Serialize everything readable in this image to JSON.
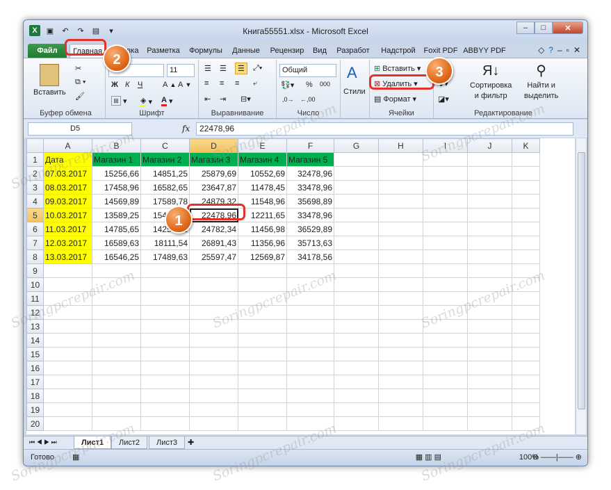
{
  "window": {
    "title": "Книга55551.xlsx - Microsoft Excel",
    "file_tab": "Файл",
    "tabs": [
      "Главная",
      "Вставка",
      "Разметка",
      "Формулы",
      "Данные",
      "Рецензир",
      "Вид",
      "Разработ",
      "Надстрой",
      "Foxit PDF",
      "ABBYY PDF"
    ]
  },
  "ribbon": {
    "clipboard": {
      "paste": "Вставить",
      "label": "Буфер обмена"
    },
    "font": {
      "name": "",
      "size": "11",
      "bold": "Ж",
      "italic": "К",
      "underline": "Ч",
      "label": "Шрифт"
    },
    "alignment": {
      "label": "Выравнивание"
    },
    "number": {
      "format": "Общий",
      "percent": "%",
      "thousands": "000",
      "label": "Число"
    },
    "styles": {
      "label": "Стили"
    },
    "cells": {
      "insert": "Вставить",
      "delete": "Удалить",
      "format": "Формат",
      "label": "Ячейки"
    },
    "editing": {
      "sort": "Сортировка",
      "sort2": "и фильтр",
      "find": "Найти и",
      "find2": "выделить",
      "label": "Редактирование"
    }
  },
  "formula": {
    "name_box": "D5",
    "fx": "fx",
    "value": "22478,96"
  },
  "grid": {
    "columns": [
      "A",
      "B",
      "C",
      "D",
      "E",
      "F",
      "G",
      "H",
      "I",
      "J",
      "K"
    ],
    "header_row": [
      "Дата",
      "Магазин 1",
      "Магазин 2",
      "Магазин 3",
      "Магазин 4",
      "Магазин 5"
    ],
    "rows": [
      [
        "07.03.2017",
        "15256,66",
        "14851,25",
        "25879,69",
        "10552,69",
        "32478,96"
      ],
      [
        "08.03.2017",
        "17458,96",
        "16582,65",
        "23647,87",
        "11478,45",
        "33478,96"
      ],
      [
        "09.03.2017",
        "14569,89",
        "17589,78",
        "24879,32",
        "11548,96",
        "35698,89"
      ],
      [
        "10.03.2017",
        "13589,25",
        "15478,32",
        "22478,96",
        "12211,65",
        "33478,96"
      ],
      [
        "11.03.2017",
        "14785,65",
        "14256,32",
        "24782,34",
        "11456,98",
        "36529,89"
      ],
      [
        "12.03.2017",
        "16589,63",
        "18111,54",
        "26891,43",
        "11356,96",
        "35713,63"
      ],
      [
        "13.03.2017",
        "16546,25",
        "17489,63",
        "25597,47",
        "12569,87",
        "34178,56"
      ]
    ],
    "row_numbers": [
      "1",
      "2",
      "3",
      "4",
      "5",
      "6",
      "7",
      "8",
      "9",
      "10",
      "11",
      "12",
      "13",
      "14",
      "15",
      "16",
      "17",
      "18",
      "19",
      "20"
    ]
  },
  "sheets": [
    "Лист1",
    "Лист2",
    "Лист3"
  ],
  "status": {
    "ready": "Готово",
    "zoom": "100%"
  },
  "callouts": [
    "1",
    "2",
    "3"
  ],
  "watermark": "Soringpcrepair.com"
}
